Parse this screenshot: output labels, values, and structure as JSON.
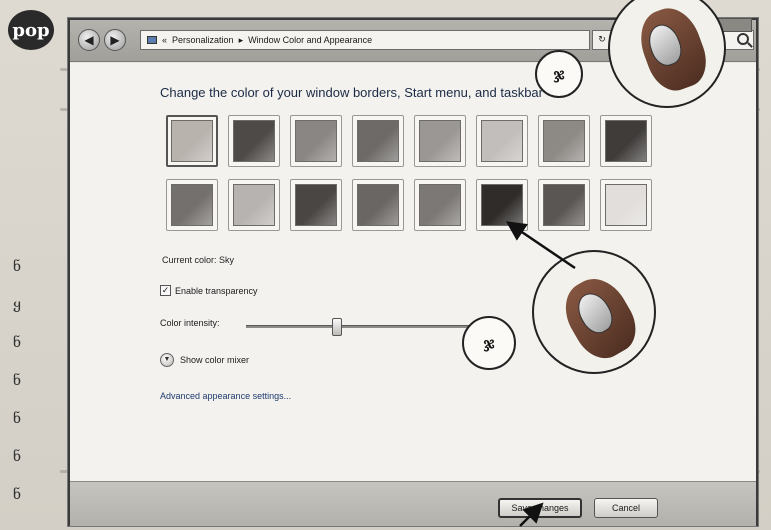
{
  "page": {
    "logo_text": "pop",
    "margin_chars": [
      "ნ",
      "ყ",
      "ნ",
      "ნ",
      "ნ",
      "ნ",
      "ნ"
    ]
  },
  "window": {
    "breadcrumb": [
      "Personalization",
      "Window Color and Appearance"
    ],
    "breadcrumb_separator": "▸",
    "heading": "Change the color of your window borders, Start menu, and taskbar",
    "current_color_label": "Current color: Sky",
    "enable_transparency_label": "Enable transparency",
    "enable_transparency_checked": true,
    "color_intensity_label": "Color intensity:",
    "color_intensity_value": 0.38,
    "show_color_mixer_label": "Show color mixer",
    "advanced_link": "Advanced appearance settings...",
    "save_label": "Save changes",
    "cancel_label": "Cancel",
    "swatches": [
      {
        "color": "#b9b3ae",
        "selected": true
      },
      {
        "color": "#4e4a47"
      },
      {
        "color": "#8a8683"
      },
      {
        "color": "#6d6a67"
      },
      {
        "color": "#9b9794"
      },
      {
        "color": "#c2bebb"
      },
      {
        "color": "#8d8985"
      },
      {
        "color": "#3f3c3a"
      },
      {
        "color": "#74706d"
      },
      {
        "color": "#b7b3b0"
      },
      {
        "color": "#4a4644"
      },
      {
        "color": "#6a6663"
      },
      {
        "color": "#7c7875"
      },
      {
        "color": "#2f2c2a"
      },
      {
        "color": "#5a5653"
      },
      {
        "color": "#e1dedb"
      }
    ]
  },
  "annotations": {
    "callout_1": "ჯ",
    "callout_2": "ჯ"
  }
}
